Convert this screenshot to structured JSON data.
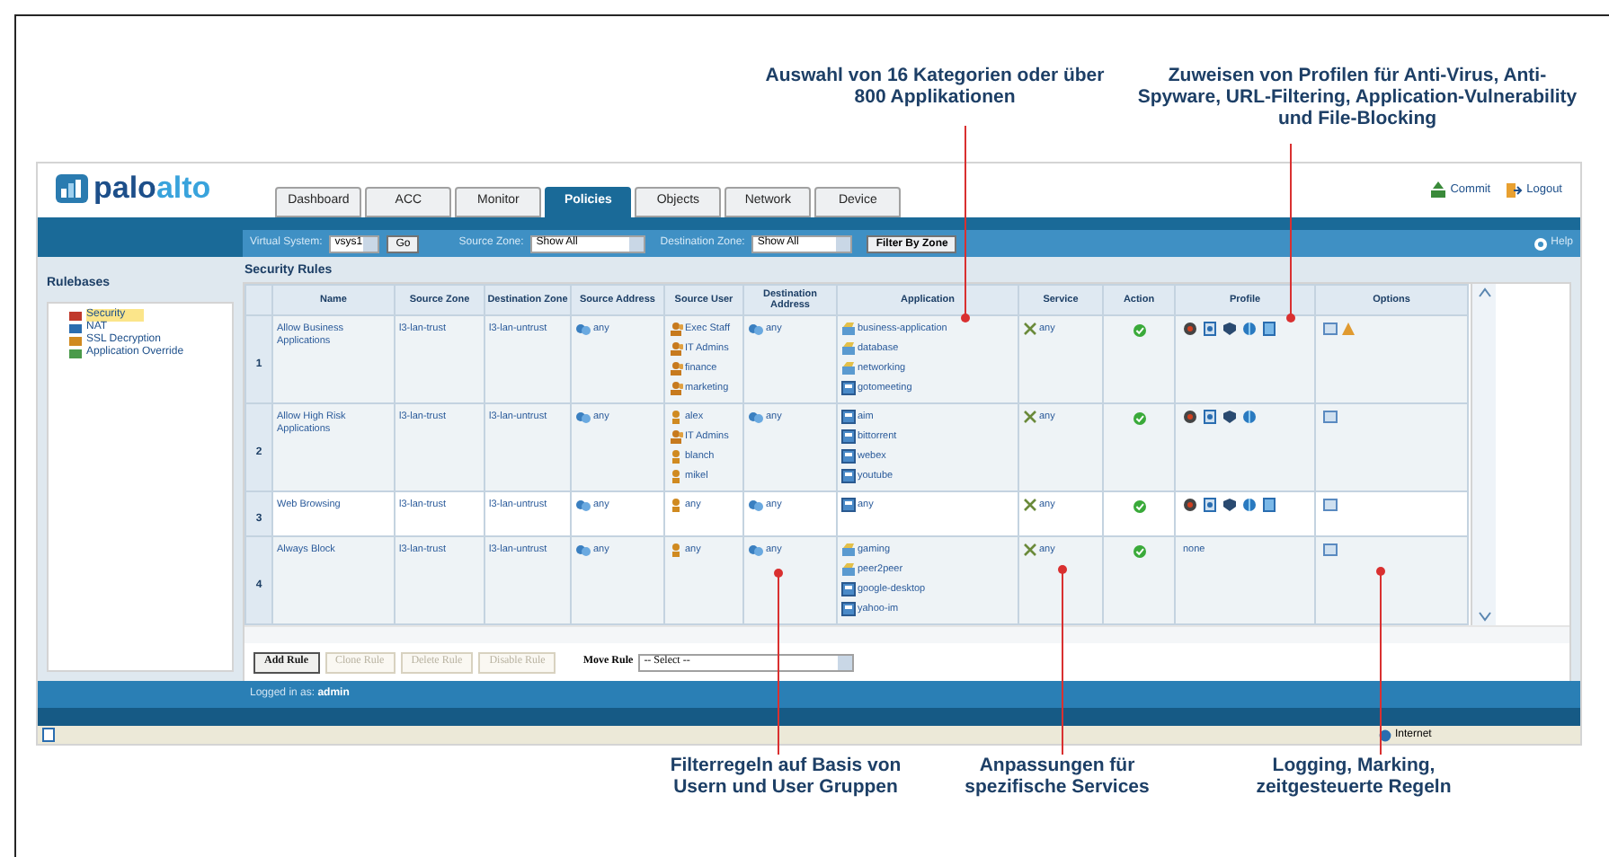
{
  "annotations_top": [
    "Auswahl von 16 Kategorien oder über 800 Applikationen",
    "Zuweisen von Profilen für Anti-Virus, Anti-Spyware, URL-Filtering, Application-Vulnerability und File-Blocking"
  ],
  "logo": {
    "first": "palo",
    "second": "alto"
  },
  "tabs": [
    {
      "label": "Dashboard",
      "selected": false
    },
    {
      "label": "ACC",
      "selected": false
    },
    {
      "label": "Monitor",
      "selected": false
    },
    {
      "label": "Policies",
      "selected": true
    },
    {
      "label": "Objects",
      "selected": false
    },
    {
      "label": "Network",
      "selected": false
    },
    {
      "label": "Device",
      "selected": false
    }
  ],
  "header_links": [
    "Commit",
    "Logout"
  ],
  "filter_bar": {
    "virtual_system_label": "Virtual System:",
    "virtual_system": "vsys1",
    "go": "Go",
    "source_zone_label": "Source Zone:",
    "source_zone": "Show All",
    "destination_zone_label": "Destination Zone:",
    "destination_zone": "Show All",
    "filter_button": "Filter By Zone",
    "help": "Help"
  },
  "sidebar": {
    "title": "Rulebases",
    "items": [
      {
        "label": "Security",
        "selected": true
      },
      {
        "label": "NAT",
        "selected": false
      },
      {
        "label": "SSL Decryption",
        "selected": false
      },
      {
        "label": "Application Override",
        "selected": false
      }
    ]
  },
  "section_title": "Security Rules",
  "table": {
    "columns": [
      "Name",
      "Source Zone",
      "Destination Zone",
      "Source Address",
      "Source User",
      "Destination Address",
      "Application",
      "Service",
      "Action",
      "Profile",
      "Options"
    ],
    "rows": [
      {
        "number": "1",
        "selected": false,
        "name": "Allow Business Applications",
        "source_zone": "l3-lan-trust",
        "destination_zone": "l3-lan-untrust",
        "source_address": "any",
        "source_users": [
          {
            "name": "Exec Staff",
            "kind": "group"
          },
          {
            "name": "IT Admins",
            "kind": "group"
          },
          {
            "name": "finance",
            "kind": "group"
          },
          {
            "name": "marketing",
            "kind": "group"
          }
        ],
        "destination_address": "any",
        "applications": [
          {
            "name": "business-application",
            "kind": "category"
          },
          {
            "name": "database",
            "kind": "category"
          },
          {
            "name": "networking",
            "kind": "category"
          },
          {
            "name": "gotomeeting",
            "kind": "app"
          }
        ],
        "service": "any",
        "allowed": true,
        "profiles": [
          {
            "kind": "virus"
          },
          {
            "kind": "spyware"
          },
          {
            "kind": "vulnerability"
          },
          {
            "kind": "url"
          },
          {
            "kind": "file"
          }
        ],
        "options": [
          {
            "kind": "log"
          },
          {
            "kind": "schedule"
          }
        ]
      },
      {
        "number": "2",
        "selected": false,
        "name": "Allow High Risk Applications",
        "source_zone": "l3-lan-trust",
        "destination_zone": "l3-lan-untrust",
        "source_address": "any",
        "source_users": [
          {
            "name": "alex",
            "kind": "user"
          },
          {
            "name": "IT Admins",
            "kind": "group"
          },
          {
            "name": "blanch",
            "kind": "user"
          },
          {
            "name": "mikel",
            "kind": "user"
          }
        ],
        "destination_address": "any",
        "applications": [
          {
            "name": "aim",
            "kind": "app"
          },
          {
            "name": "bittorrent",
            "kind": "app"
          },
          {
            "name": "webex",
            "kind": "app"
          },
          {
            "name": "youtube",
            "kind": "app"
          }
        ],
        "service": "any",
        "allowed": true,
        "profiles": [
          {
            "kind": "virus"
          },
          {
            "kind": "spyware"
          },
          {
            "kind": "vulnerability"
          },
          {
            "kind": "url"
          }
        ],
        "options": [
          {
            "kind": "log"
          }
        ]
      },
      {
        "number": "3",
        "selected": true,
        "name": "Web Browsing",
        "source_zone": "l3-lan-trust",
        "destination_zone": "l3-lan-untrust",
        "source_address": "any",
        "source_users": [
          {
            "name": "any",
            "kind": "user"
          }
        ],
        "destination_address": "any",
        "applications": [
          {
            "name": "any",
            "kind": "app"
          }
        ],
        "service": "any",
        "allowed": true,
        "profiles": [
          {
            "kind": "virus"
          },
          {
            "kind": "spyware"
          },
          {
            "kind": "vulnerability"
          },
          {
            "kind": "url"
          },
          {
            "kind": "file"
          }
        ],
        "options": [
          {
            "kind": "log"
          }
        ]
      },
      {
        "number": "4",
        "selected": false,
        "name": "Always Block",
        "source_zone": "l3-lan-trust",
        "destination_zone": "l3-lan-untrust",
        "source_address": "any",
        "source_users": [
          {
            "name": "any",
            "kind": "user"
          }
        ],
        "destination_address": "any",
        "applications": [
          {
            "name": "gaming",
            "kind": "category"
          },
          {
            "name": "peer2peer",
            "kind": "category"
          },
          {
            "name": "google-desktop",
            "kind": "app"
          },
          {
            "name": "yahoo-im",
            "kind": "app"
          }
        ],
        "service": "any",
        "allowed": true,
        "profile_text": "none",
        "options": [
          {
            "kind": "log"
          }
        ]
      }
    ]
  },
  "rule_buttons": [
    {
      "label": "Add Rule",
      "disabled": false
    },
    {
      "label": "Clone Rule",
      "disabled": true
    },
    {
      "label": "Delete Rule",
      "disabled": true
    },
    {
      "label": "Disable Rule",
      "disabled": true
    }
  ],
  "move_rule": {
    "label": "Move Rule",
    "value": "-- Select --"
  },
  "footer": {
    "label": "Logged in as:",
    "user": "admin"
  },
  "status_bar": {
    "zone": "Internet"
  },
  "annotations_bottom": [
    "Filterregeln auf Basis von Usern und User Gruppen",
    "Anpassungen für spezifische Services",
    "Logging, Marking, zeitgesteuerte Regeln"
  ]
}
